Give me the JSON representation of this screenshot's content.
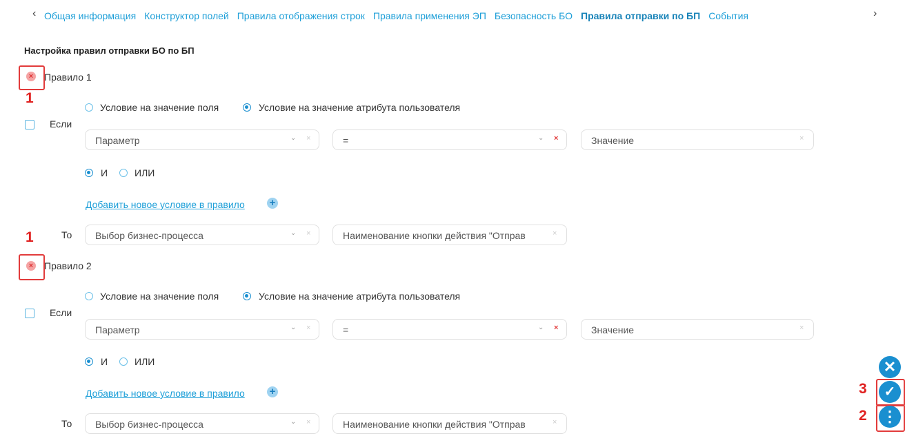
{
  "tabs": {
    "items": [
      "Общая информация",
      "Конструктор полей",
      "Правила отображения строк",
      "Правила применения ЭП",
      "Безопасность БО",
      "Правила отправки по БП",
      "События"
    ],
    "active": "Правила отправки по БП"
  },
  "page_title": "Настройка правил отправки БО по БП",
  "rules": [
    {
      "label": "Правило 1",
      "radio_field": "Условие на значение поля",
      "radio_user_attr": "Условие на значение атрибута пользователя",
      "if_label": "Если",
      "param_placeholder": "Параметр",
      "op_value": "=",
      "value_placeholder": "Значение",
      "and_label": "И",
      "or_label": "ИЛИ",
      "add_condition": "Добавить новое условие в правило",
      "then_label": "То",
      "bp_placeholder": "Выбор бизнес-процесса",
      "button_name_value": "Наименование кнопки действия \"Отправ"
    },
    {
      "label": "Правило 2",
      "radio_field": "Условие на значение поля",
      "radio_user_attr": "Условие на значение атрибута пользователя",
      "if_label": "Если",
      "param_placeholder": "Параметр",
      "op_value": "=",
      "value_placeholder": "Значение",
      "and_label": "И",
      "or_label": "ИЛИ",
      "add_condition": "Добавить новое условие в правило",
      "then_label": "То",
      "bp_placeholder": "Выбор бизнес-процесса",
      "button_name_value": "Наименование кнопки действия \"Отправ"
    }
  ],
  "annotations": [
    "1",
    "1",
    "3",
    "2"
  ],
  "icons": {
    "prev": "‹",
    "next": "›",
    "remove_rule": "×",
    "dropdown": "⌄",
    "clear": "×",
    "add": "+",
    "close_fab": "✕",
    "confirm_fab": "✓",
    "menu_fab": "⋮"
  },
  "colors": {
    "accent": "#1a8fd0",
    "link": "#1e9fd8",
    "annotation": "#e0201f"
  }
}
